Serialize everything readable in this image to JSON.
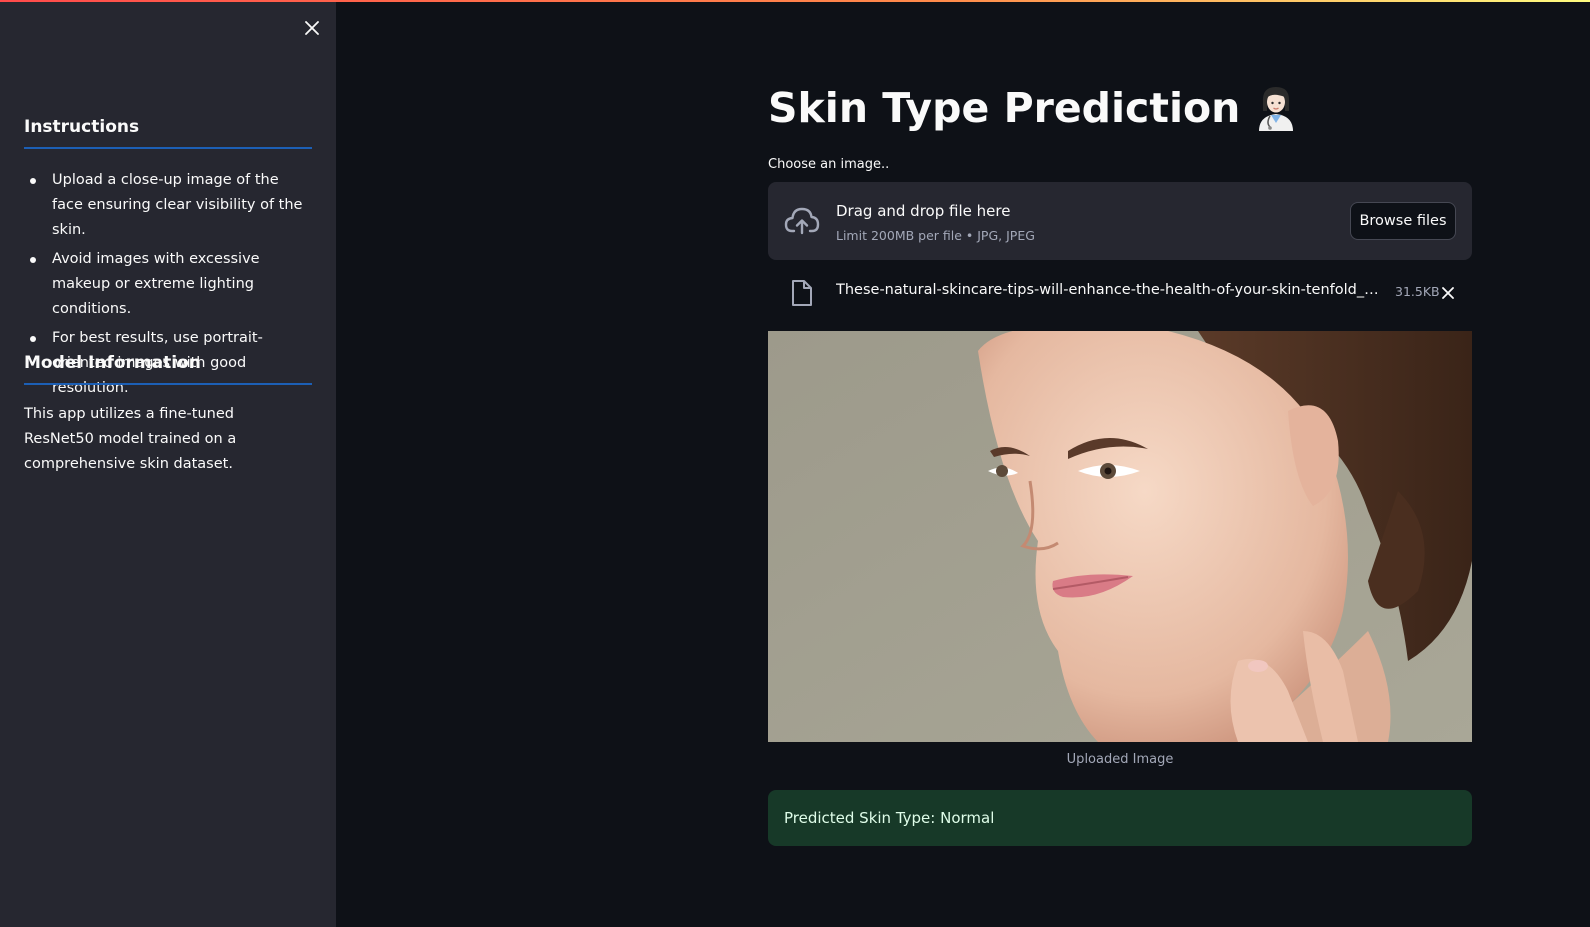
{
  "sidebar": {
    "close_icon": "close-icon",
    "instructions_heading": "Instructions",
    "instructions": [
      "Upload a close-up image of the face ensuring clear visibility of the skin.",
      "Avoid images with excessive makeup or extreme lighting conditions.",
      "For best results, use portrait-oriented images with good resolution."
    ],
    "model_heading": "Model Information",
    "model_text": "This app utilizes a fine-tuned ResNet50 model trained on a comprehensive skin dataset."
  },
  "main": {
    "title": "Skin Type Prediction",
    "title_icon": "doctor-emoji-icon",
    "uploader": {
      "label": "Choose an image..",
      "drop_text": "Drag and drop file here",
      "limit_text": "Limit 200MB per file • JPG, JPEG",
      "browse_label": "Browse files",
      "upload_icon": "cloud-upload-icon"
    },
    "file": {
      "name": "These-natural-skincare-tips-will-enhance-the-health-of-your-skin-tenfold_Mobile-Image.jpg",
      "size": "31.5KB",
      "file_icon": "file-icon",
      "remove_icon": "close-icon"
    },
    "image_caption": "Uploaded Image",
    "result": "Predicted Skin Type: Normal"
  },
  "colors": {
    "accent": "#ff4b4b",
    "background": "#0e1117",
    "sidebar": "#262730",
    "heading_rule": "#1c5fb5",
    "success_bg": "#173928",
    "success_text": "#dffde9"
  }
}
